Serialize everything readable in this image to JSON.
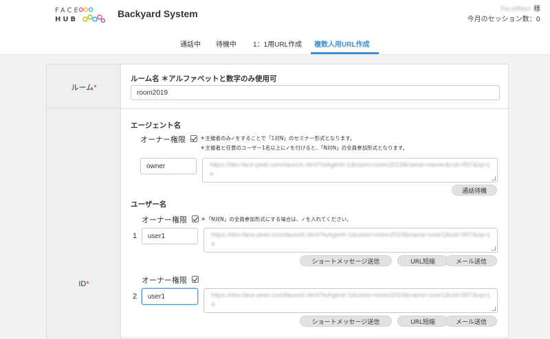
{
  "header": {
    "logo_line1": "FACE",
    "logo_line2": "HUB",
    "app_title": "Backyard System",
    "user_name": "FacePeer",
    "user_suffix": " 様",
    "session_count": "今月のセッション数：0"
  },
  "tabs": [
    {
      "label": "通話中",
      "active": false
    },
    {
      "label": "待機中",
      "active": false
    },
    {
      "label": "1：1用URL作成",
      "active": false
    },
    {
      "label": "複数人用URL作成",
      "active": true
    }
  ],
  "colors": {
    "accent": "#3a8fd6",
    "required": "#d9241b"
  },
  "form": {
    "room": {
      "row_label": "ルーム",
      "required_mark": "*",
      "field_title": "ルーム名 ＊アルファベットと数字のみ使用可",
      "value": "room2019"
    },
    "id": {
      "row_label": "ID",
      "required_mark": "*",
      "agent": {
        "title": "エージェント名",
        "owner_label": "オーナー権限",
        "owner_checked": true,
        "note_line1": "＊主催者のみ✓をすることで「1対N」のセミナー形式となります。",
        "note_line2": "＊主催者と任意のユーザー1名以上に✓を付けると、「N対N」の全員参加形式となります。",
        "name": "owner",
        "url": "https://dev.face-peer.com/launch.html?isAgent=1&room=room2019&name=owner&cid=997&op=ja",
        "wait_button": "通話待機"
      },
      "users": {
        "title": "ユーザー名",
        "note": "＊「N対N」の全員参加形式にする場合は、✓を入れてください。",
        "items": [
          {
            "number": "1",
            "owner_label": "オーナー権限",
            "owner_checked": true,
            "name": "user1",
            "url": "https://dev.face-peer.com/launch.html?isAgent=1&room=room2019&name=user1&cid=997&op=ja",
            "buttons": [
              "ショートメッセージ送信",
              "URL短縮",
              "メール送信"
            ]
          },
          {
            "number": "2",
            "owner_label": "オーナー権限",
            "owner_checked": true,
            "name": "user1",
            "url": "https://dev.face-peer.com/launch.html?isAgent=1&room=room2019&name=user1&cid=997&op=ja",
            "buttons": [
              "ショートメッセージ送信",
              "URL短縮",
              "メール送信"
            ]
          }
        ]
      }
    }
  }
}
